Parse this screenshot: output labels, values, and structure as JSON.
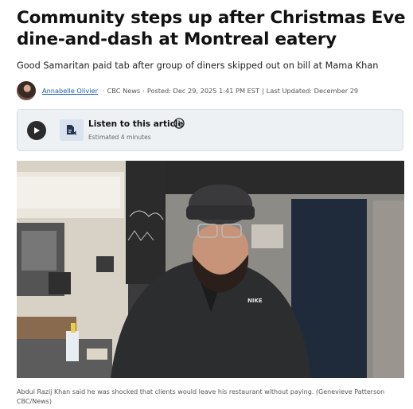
{
  "article": {
    "headline": "Community steps up after Christmas Eve dine-and-dash at Montreal eatery",
    "deck": "Good Samaritan paid tab after group of diners skipped out on bill at Mama Khan",
    "byline": {
      "author": "Annabelle Olivier",
      "outlet": "CBC News",
      "posted": "Posted: Dec 29, 2025 1:41 PM EST",
      "updated": "Last Updated: December 29"
    },
    "audio": {
      "title": "Listen to this article",
      "estimate": "Estimated 4 minutes"
    },
    "photo": {
      "sweater_logo": "NIKE",
      "caption": "Abdul Razij Khan said he was shocked that clients would leave his restaurant without paying. (Genevieve Patterson CBC/News)"
    }
  },
  "icons": {
    "play": "play-icon",
    "audio_doc": "document-audio-icon",
    "info": "info-icon"
  },
  "colors": {
    "link": "#1a5fb4",
    "player_bg": "#eef1f4",
    "text": "#111111"
  }
}
